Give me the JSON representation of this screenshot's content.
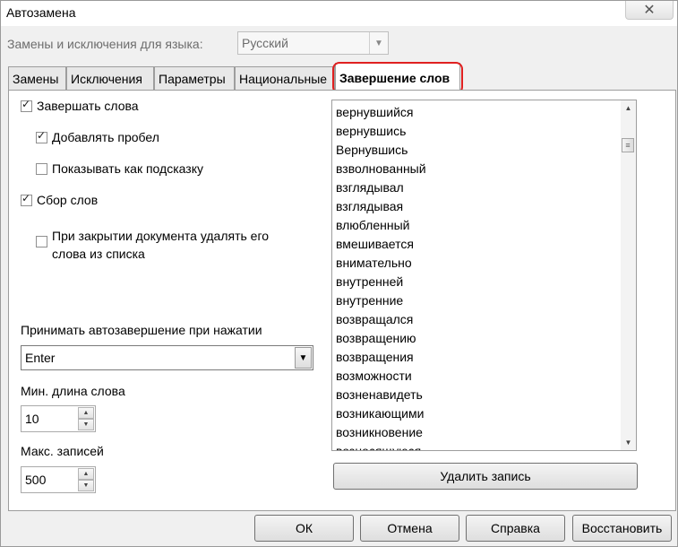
{
  "window": {
    "title": "Автозамена",
    "close_glyph": "✕"
  },
  "language": {
    "label": "Замены и исключения для языка:",
    "value": "Русский"
  },
  "tabs": [
    {
      "label": "Замены"
    },
    {
      "label": "Исключения"
    },
    {
      "label": "Параметры"
    },
    {
      "label": "Национальные"
    },
    {
      "label": "Завершение слов",
      "active": true
    }
  ],
  "options": {
    "complete_words": {
      "label": "Завершать слова",
      "checked": true
    },
    "append_space": {
      "label": "Добавлять пробел",
      "checked": true
    },
    "show_as_tip": {
      "label": "Показывать как подсказку",
      "checked": false
    },
    "collect_words": {
      "label": "Сбор слов",
      "checked": true
    },
    "remove_on_close": {
      "label_line1": "При закрытии документа удалять его",
      "label_line2": "слова из списка",
      "checked": false
    }
  },
  "accept": {
    "label": "Принимать автозавершение при нажатии",
    "value": "Enter"
  },
  "min_length": {
    "label": "Мин. длина слова",
    "value": "10"
  },
  "max_entries": {
    "label": "Макс. записей",
    "value": "500"
  },
  "word_list": [
    "вернувшийся",
    "вернувшись",
    "Вернувшись",
    "взволнованный",
    "взглядывал",
    "взглядывая",
    "влюбленный",
    "вмешивается",
    "внимательно",
    "внутренней",
    "внутренние",
    "возвращался",
    "возвращению",
    "возвращения",
    "возможности",
    "возненавидеть",
    "возникающими",
    "возникновение",
    "возносящуюся"
  ],
  "delete_entry_label": "Удалить запись",
  "footer": {
    "ok": "ОК",
    "cancel": "Отмена",
    "help": "Справка",
    "reset": "Восстановить"
  },
  "colors": {
    "highlight": "#e02020",
    "dialog_bg": "#f0f0f0"
  }
}
